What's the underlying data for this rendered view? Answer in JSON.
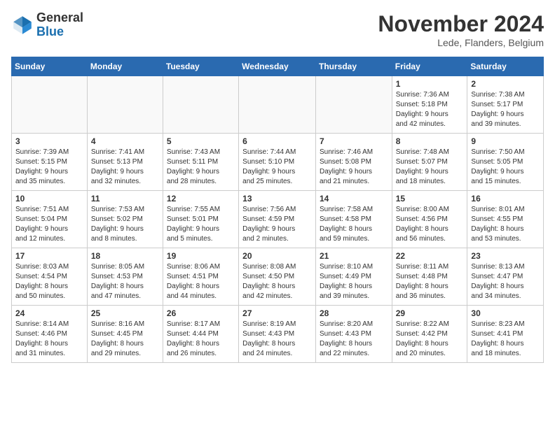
{
  "header": {
    "logo_general": "General",
    "logo_blue": "Blue",
    "month_title": "November 2024",
    "location": "Lede, Flanders, Belgium"
  },
  "days_of_week": [
    "Sunday",
    "Monday",
    "Tuesday",
    "Wednesday",
    "Thursday",
    "Friday",
    "Saturday"
  ],
  "weeks": [
    [
      {
        "day": "",
        "info": ""
      },
      {
        "day": "",
        "info": ""
      },
      {
        "day": "",
        "info": ""
      },
      {
        "day": "",
        "info": ""
      },
      {
        "day": "",
        "info": ""
      },
      {
        "day": "1",
        "info": "Sunrise: 7:36 AM\nSunset: 5:18 PM\nDaylight: 9 hours\nand 42 minutes."
      },
      {
        "day": "2",
        "info": "Sunrise: 7:38 AM\nSunset: 5:17 PM\nDaylight: 9 hours\nand 39 minutes."
      }
    ],
    [
      {
        "day": "3",
        "info": "Sunrise: 7:39 AM\nSunset: 5:15 PM\nDaylight: 9 hours\nand 35 minutes."
      },
      {
        "day": "4",
        "info": "Sunrise: 7:41 AM\nSunset: 5:13 PM\nDaylight: 9 hours\nand 32 minutes."
      },
      {
        "day": "5",
        "info": "Sunrise: 7:43 AM\nSunset: 5:11 PM\nDaylight: 9 hours\nand 28 minutes."
      },
      {
        "day": "6",
        "info": "Sunrise: 7:44 AM\nSunset: 5:10 PM\nDaylight: 9 hours\nand 25 minutes."
      },
      {
        "day": "7",
        "info": "Sunrise: 7:46 AM\nSunset: 5:08 PM\nDaylight: 9 hours\nand 21 minutes."
      },
      {
        "day": "8",
        "info": "Sunrise: 7:48 AM\nSunset: 5:07 PM\nDaylight: 9 hours\nand 18 minutes."
      },
      {
        "day": "9",
        "info": "Sunrise: 7:50 AM\nSunset: 5:05 PM\nDaylight: 9 hours\nand 15 minutes."
      }
    ],
    [
      {
        "day": "10",
        "info": "Sunrise: 7:51 AM\nSunset: 5:04 PM\nDaylight: 9 hours\nand 12 minutes."
      },
      {
        "day": "11",
        "info": "Sunrise: 7:53 AM\nSunset: 5:02 PM\nDaylight: 9 hours\nand 8 minutes."
      },
      {
        "day": "12",
        "info": "Sunrise: 7:55 AM\nSunset: 5:01 PM\nDaylight: 9 hours\nand 5 minutes."
      },
      {
        "day": "13",
        "info": "Sunrise: 7:56 AM\nSunset: 4:59 PM\nDaylight: 9 hours\nand 2 minutes."
      },
      {
        "day": "14",
        "info": "Sunrise: 7:58 AM\nSunset: 4:58 PM\nDaylight: 8 hours\nand 59 minutes."
      },
      {
        "day": "15",
        "info": "Sunrise: 8:00 AM\nSunset: 4:56 PM\nDaylight: 8 hours\nand 56 minutes."
      },
      {
        "day": "16",
        "info": "Sunrise: 8:01 AM\nSunset: 4:55 PM\nDaylight: 8 hours\nand 53 minutes."
      }
    ],
    [
      {
        "day": "17",
        "info": "Sunrise: 8:03 AM\nSunset: 4:54 PM\nDaylight: 8 hours\nand 50 minutes."
      },
      {
        "day": "18",
        "info": "Sunrise: 8:05 AM\nSunset: 4:53 PM\nDaylight: 8 hours\nand 47 minutes."
      },
      {
        "day": "19",
        "info": "Sunrise: 8:06 AM\nSunset: 4:51 PM\nDaylight: 8 hours\nand 44 minutes."
      },
      {
        "day": "20",
        "info": "Sunrise: 8:08 AM\nSunset: 4:50 PM\nDaylight: 8 hours\nand 42 minutes."
      },
      {
        "day": "21",
        "info": "Sunrise: 8:10 AM\nSunset: 4:49 PM\nDaylight: 8 hours\nand 39 minutes."
      },
      {
        "day": "22",
        "info": "Sunrise: 8:11 AM\nSunset: 4:48 PM\nDaylight: 8 hours\nand 36 minutes."
      },
      {
        "day": "23",
        "info": "Sunrise: 8:13 AM\nSunset: 4:47 PM\nDaylight: 8 hours\nand 34 minutes."
      }
    ],
    [
      {
        "day": "24",
        "info": "Sunrise: 8:14 AM\nSunset: 4:46 PM\nDaylight: 8 hours\nand 31 minutes."
      },
      {
        "day": "25",
        "info": "Sunrise: 8:16 AM\nSunset: 4:45 PM\nDaylight: 8 hours\nand 29 minutes."
      },
      {
        "day": "26",
        "info": "Sunrise: 8:17 AM\nSunset: 4:44 PM\nDaylight: 8 hours\nand 26 minutes."
      },
      {
        "day": "27",
        "info": "Sunrise: 8:19 AM\nSunset: 4:43 PM\nDaylight: 8 hours\nand 24 minutes."
      },
      {
        "day": "28",
        "info": "Sunrise: 8:20 AM\nSunset: 4:43 PM\nDaylight: 8 hours\nand 22 minutes."
      },
      {
        "day": "29",
        "info": "Sunrise: 8:22 AM\nSunset: 4:42 PM\nDaylight: 8 hours\nand 20 minutes."
      },
      {
        "day": "30",
        "info": "Sunrise: 8:23 AM\nSunset: 4:41 PM\nDaylight: 8 hours\nand 18 minutes."
      }
    ]
  ]
}
